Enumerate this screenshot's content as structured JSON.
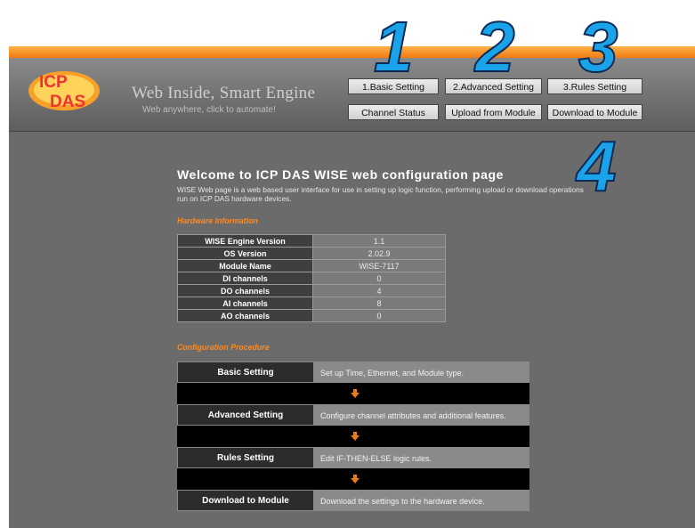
{
  "branding": {
    "logo_top": "ICP",
    "logo_bottom": "DAS",
    "tagline": "Web Inside, Smart Engine",
    "subtagline": "Web anywhere, click to automate!"
  },
  "nav": {
    "basic": "1.Basic Setting",
    "advanced": "2.Advanced Setting",
    "rules": "3.Rules Setting",
    "channel_status": "Channel Status",
    "upload": "Upload from Module",
    "download": "Download to Module"
  },
  "callouts": [
    "1",
    "2",
    "3",
    "4"
  ],
  "welcome": {
    "title": "Welcome to ICP DAS WISE web configuration page",
    "text": "WISE Web page is a web based user interface for use in setting up logic function, performing upload or download operations run on ICP DAS hardware devices."
  },
  "hardware": {
    "title": "Hardware Information",
    "rows": [
      {
        "key": "WISE Engine Version",
        "value": "1.1"
      },
      {
        "key": "OS Version",
        "value": "2.02.9"
      },
      {
        "key": "Module Name",
        "value": "WISE-7117"
      },
      {
        "key": "DI channels",
        "value": "0"
      },
      {
        "key": "DO channels",
        "value": "4"
      },
      {
        "key": "AI channels",
        "value": "8"
      },
      {
        "key": "AO channels",
        "value": "0"
      }
    ]
  },
  "procedure": {
    "title": "Configuration Procedure",
    "steps": [
      {
        "name": "Basic Setting",
        "desc": "Set up Time, Ethernet, and Module type."
      },
      {
        "name": "Advanced Setting",
        "desc": "Configure channel attributes and additional features."
      },
      {
        "name": "Rules Setting",
        "desc": "Edit IF-THEN-ELSE logic rules."
      },
      {
        "name": "Download to Module",
        "desc": "Download the settings to the hardware device."
      }
    ]
  },
  "colors": {
    "accent": "#f07a12",
    "callout": "#1aa3e8",
    "background": "#6b6b6b"
  }
}
